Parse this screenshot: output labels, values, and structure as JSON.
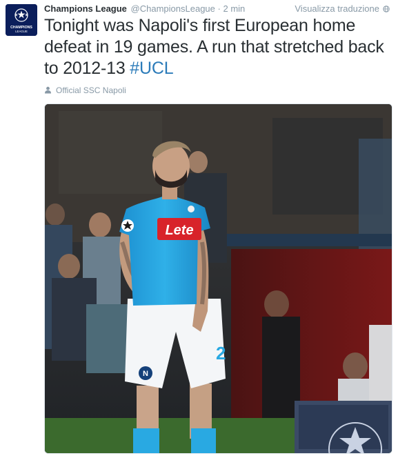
{
  "tweet": {
    "display_name": "Champions League",
    "handle": "@ChampionsLeague",
    "separator": "·",
    "time": "2 min",
    "translate_label": "Visualizza traduzione",
    "text": "Tonight was Napoli's first European home defeat in 19 games. A run that stretched back to 2012-13",
    "hashtag": "#UCL",
    "context_label": "Official SSC Napoli"
  },
  "avatar": {
    "logo_text_top": "CHAMPIONS",
    "logo_text_bottom": "LEAGUE",
    "background_color": "#0b1e5b"
  },
  "media": {
    "shirt_sponsor": "Lete",
    "shirt_number": "2",
    "icon": "player-photo"
  },
  "colors": {
    "link": "#2b7bb9",
    "muted": "#8899a6",
    "text": "#292f33",
    "napoli_blue": "#27a6e1"
  },
  "icons": {
    "avatar": "champions-league-star-ball-icon",
    "translate": "globe-icon",
    "context": "user-icon"
  }
}
